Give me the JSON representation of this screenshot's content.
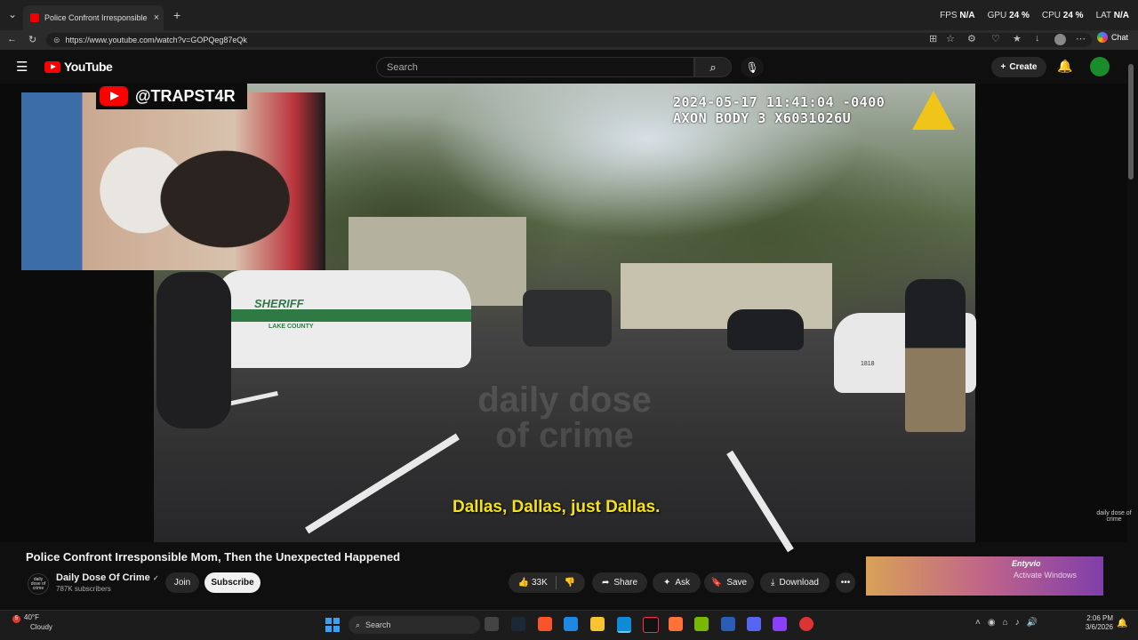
{
  "browser": {
    "tab_title": "Police Confront Irresponsible Mom",
    "tab_close": "×",
    "new_tab": "+",
    "tab_list": "⌄",
    "url": "https://www.youtube.com/watch?v=GOPQeg87eQk",
    "chat_label": "Chat"
  },
  "hud": {
    "fps_label": "FPS",
    "fps_value": "N/A",
    "gpu_label": "GPU",
    "gpu_value": "24 %",
    "cpu_label": "CPU",
    "cpu_value": "24 %",
    "lat_label": "LAT",
    "lat_value": "N/A"
  },
  "youtube": {
    "logo_text": "YouTube",
    "search_placeholder": "Search",
    "create_label": "Create"
  },
  "video": {
    "timestamp_line1": "2024-05-17 11:41:04 -0400",
    "timestamp_line2": "AXON BODY 3 X6031026U",
    "subtitle": "Dallas, Dallas, just Dallas.",
    "watermark": "daily dose of crime",
    "corner_watermark": "daily dose of crime",
    "car_text": "SHERIFF",
    "car_text2": "LAKE COUNTY",
    "car_number": "1818",
    "handle": "@TRAPST4R"
  },
  "details": {
    "title": "Police Confront Irresponsible Mom, Then the Unexpected Happened",
    "channel_name": "Daily Dose Of Crime",
    "channel_logo_text": "daily dose of crime",
    "verified": "✓",
    "subscribers": "787K subscribers",
    "join_label": "Join",
    "subscribe_label": "Subscribe",
    "likes": "33K",
    "share_label": "Share",
    "ask_label": "Ask",
    "save_label": "Save",
    "download_label": "Download",
    "more_label": "•••"
  },
  "ad": {
    "brand": "Entyvio",
    "activate_windows": "Activate Windows"
  },
  "taskbar": {
    "temperature": "40°F",
    "condition": "Cloudy",
    "weather_badge": "5",
    "search_label": "Search",
    "time": "2:06 PM",
    "date": "3/6/2026"
  },
  "colors": {
    "youtube_red": "#ff0000",
    "subtitle_yellow": "#f4e11a",
    "background": "#0f0f0f"
  }
}
